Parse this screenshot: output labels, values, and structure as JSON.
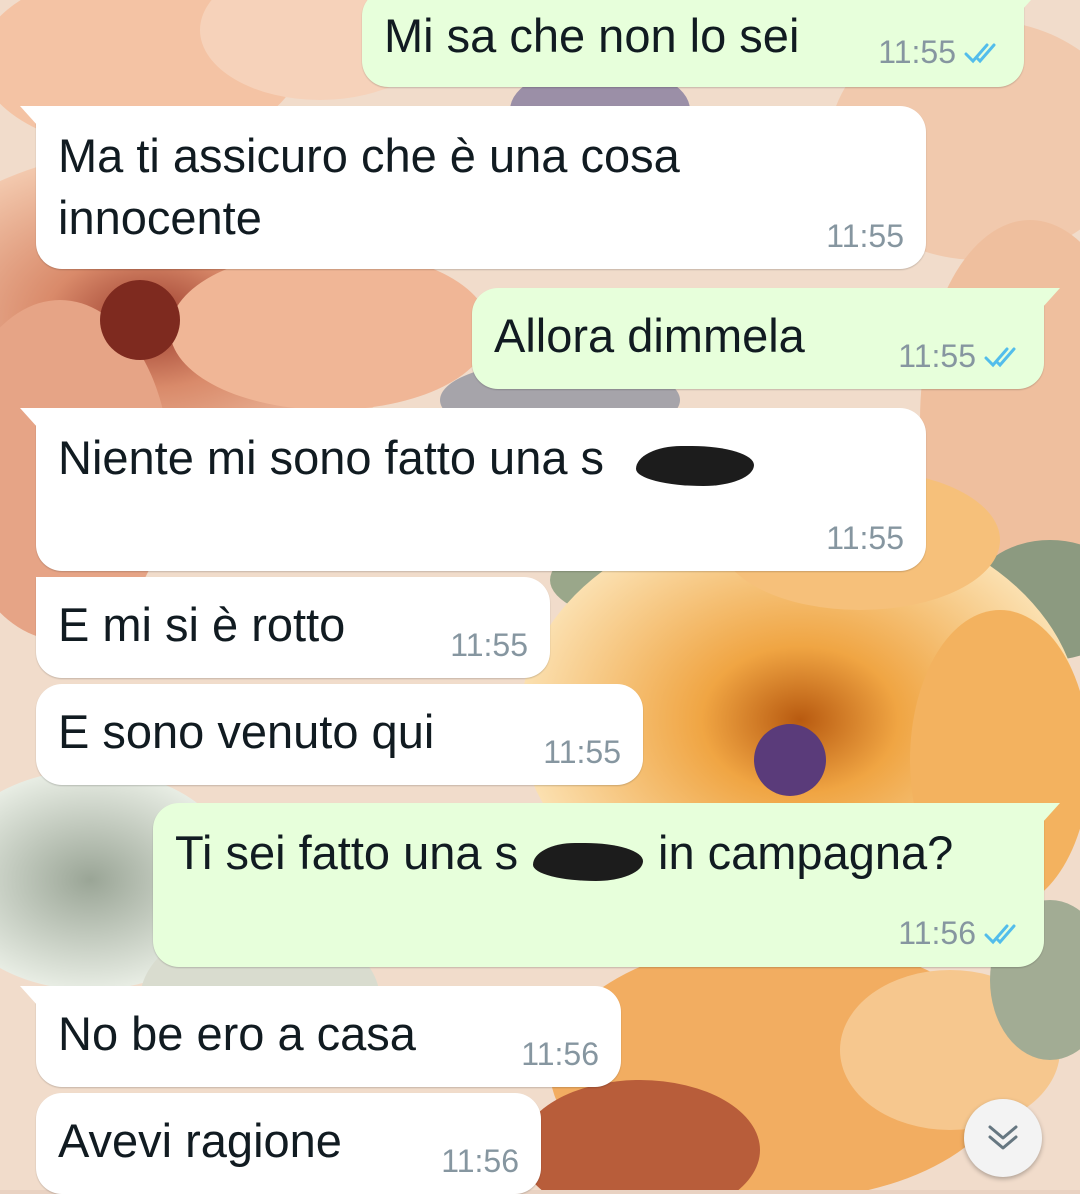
{
  "chat": {
    "messages": [
      {
        "direction": "out",
        "text": "Mi sa che non lo sei",
        "time": "11:55",
        "status": "read"
      },
      {
        "direction": "in",
        "text_line1": "Ma ti assicuro che è una cosa",
        "text_line2": "innocente",
        "time": "11:55"
      },
      {
        "direction": "out",
        "text": "Allora dimmela",
        "time": "11:55",
        "status": "read"
      },
      {
        "direction": "in",
        "text": "Niente mi sono fatto una s",
        "redacted": true,
        "time": "11:55"
      },
      {
        "direction": "in",
        "text": "E mi si è rotto",
        "time": "11:55"
      },
      {
        "direction": "in",
        "text": "E sono venuto qui",
        "time": "11:55"
      },
      {
        "direction": "out",
        "text_before": "Ti sei fatto una s",
        "text_after": "in campagna?",
        "redacted": true,
        "time": "11:56",
        "status": "read"
      },
      {
        "direction": "in",
        "text": "No be ero a casa",
        "time": "11:56"
      },
      {
        "direction": "in",
        "text": "Avevi ragione",
        "time": "11:56"
      }
    ]
  },
  "icons": {
    "read_receipt": "double-check-icon",
    "scroll_down": "double-chevron-down-icon"
  },
  "colors": {
    "incoming_bubble": "#ffffff",
    "outgoing_bubble": "#e7ffdb",
    "read_ticks": "#53bdeb",
    "timestamp": "#8696a0",
    "text": "#111b21"
  }
}
